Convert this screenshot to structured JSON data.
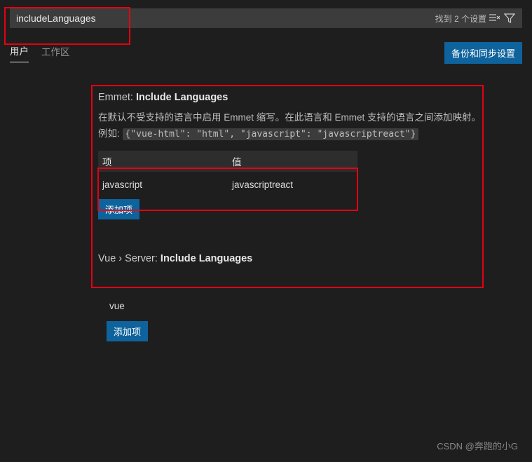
{
  "search": {
    "value": "includeLanguages",
    "result_count_label": "找到 2 个设置"
  },
  "tabs": {
    "user": "用户",
    "workspace": "工作区"
  },
  "sync_button": "备份和同步设置",
  "emmet": {
    "title_prefix": "Emmet: ",
    "title_bold": "Include Languages",
    "desc_part1": "在默认不受支持的语言中启用 Emmet 缩写。在此语言和 Emmet 支持的语言之间添加映射。 例如: ",
    "desc_code": "{\"vue-html\": \"html\", \"javascript\": \"javascriptreact\"}",
    "table": {
      "head_key": "项",
      "head_value": "值",
      "rows": [
        {
          "key": "javascript",
          "value": "javascriptreact"
        }
      ]
    },
    "add_button": "添加项"
  },
  "vue_server": {
    "title_prefix": "Vue › Server: ",
    "title_bold": "Include Languages",
    "item": "vue",
    "add_button": "添加项"
  },
  "watermark": "CSDN @奔跑的小G"
}
